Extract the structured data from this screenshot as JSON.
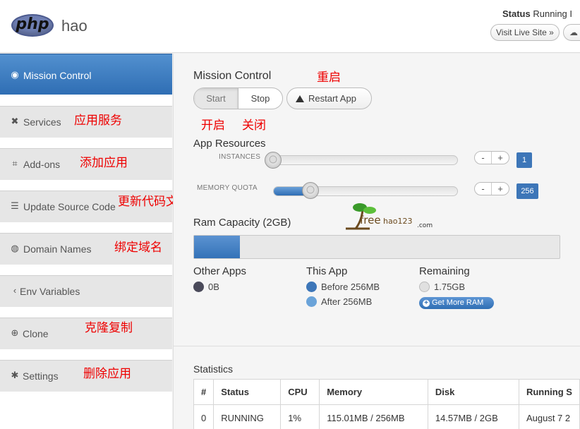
{
  "header": {
    "logo_text": "php",
    "app_name": "hao",
    "status_label": "Status",
    "status_value": "Running I",
    "visit_live_label": "Visit Live Site",
    "visit_live_icon": "»"
  },
  "sidebar": {
    "items": [
      {
        "label": "Mission Control",
        "icon": "dashboard-icon",
        "glyph": "◉"
      },
      {
        "label": "Services",
        "icon": "tools-icon",
        "glyph": "✖"
      },
      {
        "label": "Add-ons",
        "icon": "puzzle-icon",
        "glyph": "⌗"
      },
      {
        "label": "Update Source Code",
        "icon": "list-icon",
        "glyph": "☰"
      },
      {
        "label": "Domain Names",
        "icon": "globe-icon",
        "glyph": "◍"
      },
      {
        "label": "Env Variables",
        "icon": "chevron-left-icon",
        "glyph": "‹"
      },
      {
        "label": "Clone",
        "icon": "plus-circle-icon",
        "glyph": "⊕"
      },
      {
        "label": "Settings",
        "icon": "gear-icon",
        "glyph": "✱"
      }
    ]
  },
  "annotations": {
    "services": "应用服务",
    "addons": "添加应用",
    "update": "更新代码文件",
    "domain": "绑定域名",
    "clone": "克隆复制",
    "settings": "删除应用",
    "restart": "重启",
    "start": "开启",
    "stop": "关闭"
  },
  "mission": {
    "title": "Mission Control",
    "start_label": "Start",
    "stop_label": "Stop",
    "restart_label": "Restart App"
  },
  "resources": {
    "title": "App Resources",
    "instances_label": "INSTANCES",
    "instances_value": "1",
    "instances_fraction": 0.0,
    "memory_label": "MEMORY QUOTA",
    "memory_value": "256",
    "memory_fraction": 0.2,
    "minus": "-",
    "plus": "+"
  },
  "ram": {
    "title": "Ram Capacity (2GB)",
    "used_fraction": 0.125,
    "other_title": "Other Apps",
    "other_value": "0B",
    "this_title": "This App",
    "before_label": "Before 256MB",
    "after_label": "After 256MB",
    "remaining_title": "Remaining",
    "remaining_value": "1.75GB",
    "get_more_label": "Get More RAM",
    "colors": {
      "other": "#4a4a5a",
      "before": "#3d76b8",
      "after": "#6aa3d9",
      "remaining": "#e0e0e0"
    }
  },
  "watermark": {
    "text1": "free",
    "text2": "hao123",
    "text3": ".com"
  },
  "statistics": {
    "title": "Statistics",
    "columns": [
      "#",
      "Status",
      "CPU",
      "Memory",
      "Disk",
      "Running S"
    ],
    "rows": [
      [
        "0",
        "RUNNING",
        "1%",
        "115.01MB / 256MB",
        "14.57MB / 2GB",
        "August 7 2"
      ]
    ]
  }
}
